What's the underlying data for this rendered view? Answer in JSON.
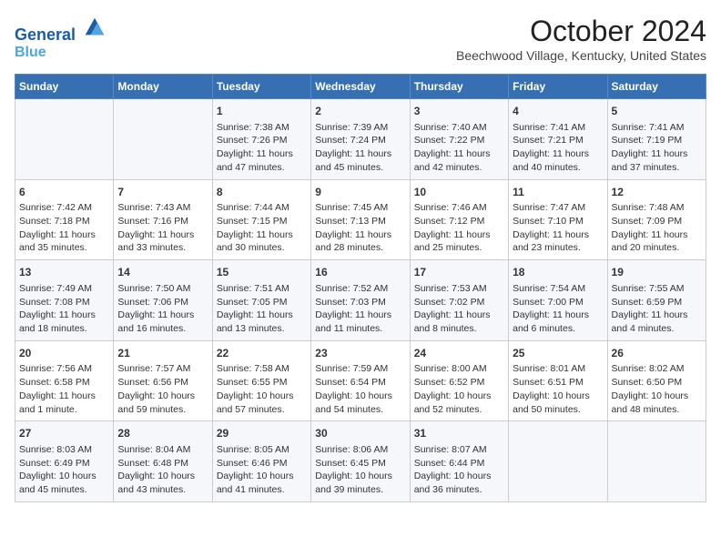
{
  "logo": {
    "line1": "General",
    "line2": "Blue"
  },
  "title": "October 2024",
  "subtitle": "Beechwood Village, Kentucky, United States",
  "days_of_week": [
    "Sunday",
    "Monday",
    "Tuesday",
    "Wednesday",
    "Thursday",
    "Friday",
    "Saturday"
  ],
  "weeks": [
    [
      {
        "day": "",
        "info": ""
      },
      {
        "day": "",
        "info": ""
      },
      {
        "day": "1",
        "info": "Sunrise: 7:38 AM\nSunset: 7:26 PM\nDaylight: 11 hours and 47 minutes."
      },
      {
        "day": "2",
        "info": "Sunrise: 7:39 AM\nSunset: 7:24 PM\nDaylight: 11 hours and 45 minutes."
      },
      {
        "day": "3",
        "info": "Sunrise: 7:40 AM\nSunset: 7:22 PM\nDaylight: 11 hours and 42 minutes."
      },
      {
        "day": "4",
        "info": "Sunrise: 7:41 AM\nSunset: 7:21 PM\nDaylight: 11 hours and 40 minutes."
      },
      {
        "day": "5",
        "info": "Sunrise: 7:41 AM\nSunset: 7:19 PM\nDaylight: 11 hours and 37 minutes."
      }
    ],
    [
      {
        "day": "6",
        "info": "Sunrise: 7:42 AM\nSunset: 7:18 PM\nDaylight: 11 hours and 35 minutes."
      },
      {
        "day": "7",
        "info": "Sunrise: 7:43 AM\nSunset: 7:16 PM\nDaylight: 11 hours and 33 minutes."
      },
      {
        "day": "8",
        "info": "Sunrise: 7:44 AM\nSunset: 7:15 PM\nDaylight: 11 hours and 30 minutes."
      },
      {
        "day": "9",
        "info": "Sunrise: 7:45 AM\nSunset: 7:13 PM\nDaylight: 11 hours and 28 minutes."
      },
      {
        "day": "10",
        "info": "Sunrise: 7:46 AM\nSunset: 7:12 PM\nDaylight: 11 hours and 25 minutes."
      },
      {
        "day": "11",
        "info": "Sunrise: 7:47 AM\nSunset: 7:10 PM\nDaylight: 11 hours and 23 minutes."
      },
      {
        "day": "12",
        "info": "Sunrise: 7:48 AM\nSunset: 7:09 PM\nDaylight: 11 hours and 20 minutes."
      }
    ],
    [
      {
        "day": "13",
        "info": "Sunrise: 7:49 AM\nSunset: 7:08 PM\nDaylight: 11 hours and 18 minutes."
      },
      {
        "day": "14",
        "info": "Sunrise: 7:50 AM\nSunset: 7:06 PM\nDaylight: 11 hours and 16 minutes."
      },
      {
        "day": "15",
        "info": "Sunrise: 7:51 AM\nSunset: 7:05 PM\nDaylight: 11 hours and 13 minutes."
      },
      {
        "day": "16",
        "info": "Sunrise: 7:52 AM\nSunset: 7:03 PM\nDaylight: 11 hours and 11 minutes."
      },
      {
        "day": "17",
        "info": "Sunrise: 7:53 AM\nSunset: 7:02 PM\nDaylight: 11 hours and 8 minutes."
      },
      {
        "day": "18",
        "info": "Sunrise: 7:54 AM\nSunset: 7:00 PM\nDaylight: 11 hours and 6 minutes."
      },
      {
        "day": "19",
        "info": "Sunrise: 7:55 AM\nSunset: 6:59 PM\nDaylight: 11 hours and 4 minutes."
      }
    ],
    [
      {
        "day": "20",
        "info": "Sunrise: 7:56 AM\nSunset: 6:58 PM\nDaylight: 11 hours and 1 minute."
      },
      {
        "day": "21",
        "info": "Sunrise: 7:57 AM\nSunset: 6:56 PM\nDaylight: 10 hours and 59 minutes."
      },
      {
        "day": "22",
        "info": "Sunrise: 7:58 AM\nSunset: 6:55 PM\nDaylight: 10 hours and 57 minutes."
      },
      {
        "day": "23",
        "info": "Sunrise: 7:59 AM\nSunset: 6:54 PM\nDaylight: 10 hours and 54 minutes."
      },
      {
        "day": "24",
        "info": "Sunrise: 8:00 AM\nSunset: 6:52 PM\nDaylight: 10 hours and 52 minutes."
      },
      {
        "day": "25",
        "info": "Sunrise: 8:01 AM\nSunset: 6:51 PM\nDaylight: 10 hours and 50 minutes."
      },
      {
        "day": "26",
        "info": "Sunrise: 8:02 AM\nSunset: 6:50 PM\nDaylight: 10 hours and 48 minutes."
      }
    ],
    [
      {
        "day": "27",
        "info": "Sunrise: 8:03 AM\nSunset: 6:49 PM\nDaylight: 10 hours and 45 minutes."
      },
      {
        "day": "28",
        "info": "Sunrise: 8:04 AM\nSunset: 6:48 PM\nDaylight: 10 hours and 43 minutes."
      },
      {
        "day": "29",
        "info": "Sunrise: 8:05 AM\nSunset: 6:46 PM\nDaylight: 10 hours and 41 minutes."
      },
      {
        "day": "30",
        "info": "Sunrise: 8:06 AM\nSunset: 6:45 PM\nDaylight: 10 hours and 39 minutes."
      },
      {
        "day": "31",
        "info": "Sunrise: 8:07 AM\nSunset: 6:44 PM\nDaylight: 10 hours and 36 minutes."
      },
      {
        "day": "",
        "info": ""
      },
      {
        "day": "",
        "info": ""
      }
    ]
  ]
}
